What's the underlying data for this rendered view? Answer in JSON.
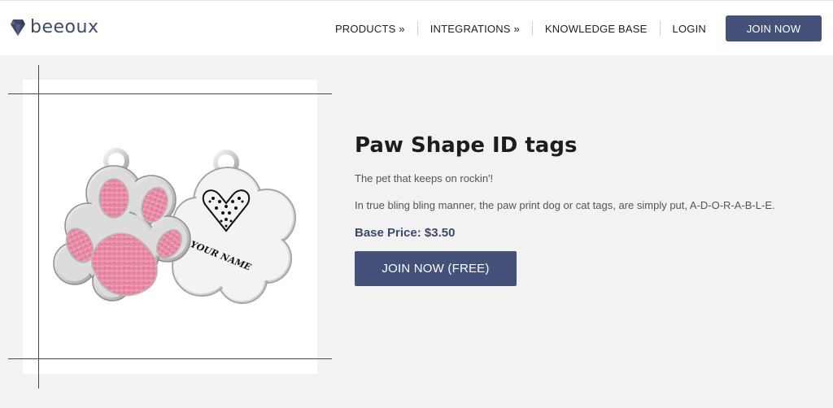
{
  "brand": {
    "name": "beeoux",
    "icon": "diamond-icon",
    "color": "#3b4a6b"
  },
  "nav": {
    "products": "PRODUCTS »",
    "integrations": "INTEGRATIONS »",
    "knowledge_base": "KNOWLEDGE BASE",
    "login": "LOGIN",
    "join": "JOIN NOW"
  },
  "product": {
    "title": "Paw Shape ID tags",
    "tagline": "The pet that keeps on rockin'!",
    "description": "In true bling bling manner, the paw print dog or cat tags, are simply put, A-D-O-R-A-B-L-E.",
    "price": "Base Price: $3.50",
    "cta": "JOIN NOW (FREE)",
    "image_engraving": "YOUR NAME"
  },
  "colors": {
    "accent": "#44527a",
    "background": "#f2f2f2",
    "glitter": "#e88aa4"
  }
}
